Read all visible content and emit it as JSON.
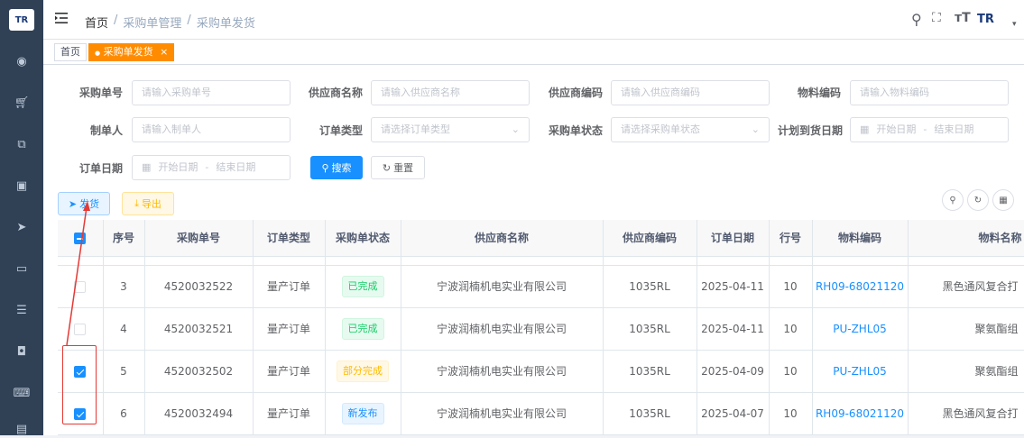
{
  "sidebar": {
    "logo": "TR",
    "icons": [
      "dashboard-icon",
      "cart-icon",
      "external-link-icon",
      "box-icon",
      "send-icon",
      "monitor-icon",
      "list-icon",
      "shield-icon",
      "keyboard-icon",
      "more-icon"
    ]
  },
  "header": {
    "breadcrumb": [
      "首页",
      "采购单管理",
      "采购单发货"
    ],
    "separator": "/",
    "user_logo": "TR"
  },
  "tags": {
    "home": "首页",
    "active": "采购单发货",
    "close": "×"
  },
  "filters": {
    "po_no": {
      "label": "采购单号",
      "placeholder": "请输入采购单号"
    },
    "supplier_name": {
      "label": "供应商名称",
      "placeholder": "请输入供应商名称"
    },
    "supplier_code": {
      "label": "供应商编码",
      "placeholder": "请输入供应商编码"
    },
    "material_code": {
      "label": "物料编码",
      "placeholder": "请输入物料编码"
    },
    "creator": {
      "label": "制单人",
      "placeholder": "请输入制单人"
    },
    "order_type": {
      "label": "订单类型",
      "placeholder": "请选择订单类型"
    },
    "po_status": {
      "label": "采购单状态",
      "placeholder": "请选择采购单状态"
    },
    "plan_date": {
      "label": "计划到货日期",
      "start": "开始日期",
      "sep": "-",
      "end": "结束日期"
    },
    "order_date": {
      "label": "订单日期",
      "start": "开始日期",
      "sep": "-",
      "end": "结束日期"
    },
    "search_btn": "搜索",
    "reset_btn": "重置"
  },
  "toolbar": {
    "send_btn": "发货",
    "export_btn": "导出"
  },
  "table": {
    "columns": [
      "序号",
      "采购单号",
      "订单类型",
      "采购单状态",
      "供应商名称",
      "供应商编码",
      "订单日期",
      "行号",
      "物料编码",
      "物料名称"
    ],
    "rows": [
      {
        "checked": false,
        "seq": "3",
        "po": "4520032522",
        "type": "量产订单",
        "status": "已完成",
        "status_kind": "done",
        "supplier": "宁波润楠机电实业有限公司",
        "code": "1035RL",
        "date": "2025-04-11",
        "line": "10",
        "material": "RH09-68021120",
        "mname": "黑色通风复合打"
      },
      {
        "checked": false,
        "seq": "4",
        "po": "4520032521",
        "type": "量产订单",
        "status": "已完成",
        "status_kind": "done",
        "supplier": "宁波润楠机电实业有限公司",
        "code": "1035RL",
        "date": "2025-04-11",
        "line": "10",
        "material": "PU-ZHL05",
        "mname": "聚氨酯组"
      },
      {
        "checked": true,
        "seq": "5",
        "po": "4520032502",
        "type": "量产订单",
        "status": "部分完成",
        "status_kind": "part",
        "supplier": "宁波润楠机电实业有限公司",
        "code": "1035RL",
        "date": "2025-04-09",
        "line": "10",
        "material": "PU-ZHL05",
        "mname": "聚氨酯组"
      },
      {
        "checked": true,
        "seq": "6",
        "po": "4520032494",
        "type": "量产订单",
        "status": "新发布",
        "status_kind": "new",
        "supplier": "宁波润楠机电实业有限公司",
        "code": "1035RL",
        "date": "2025-04-07",
        "line": "10",
        "material": "RH09-68021120",
        "mname": "黑色通风复合打"
      }
    ]
  },
  "colors": {
    "primary": "#1890ff",
    "active_tag": "#ff8c00",
    "sidebar": "#304156",
    "annotation": "#e53935"
  }
}
